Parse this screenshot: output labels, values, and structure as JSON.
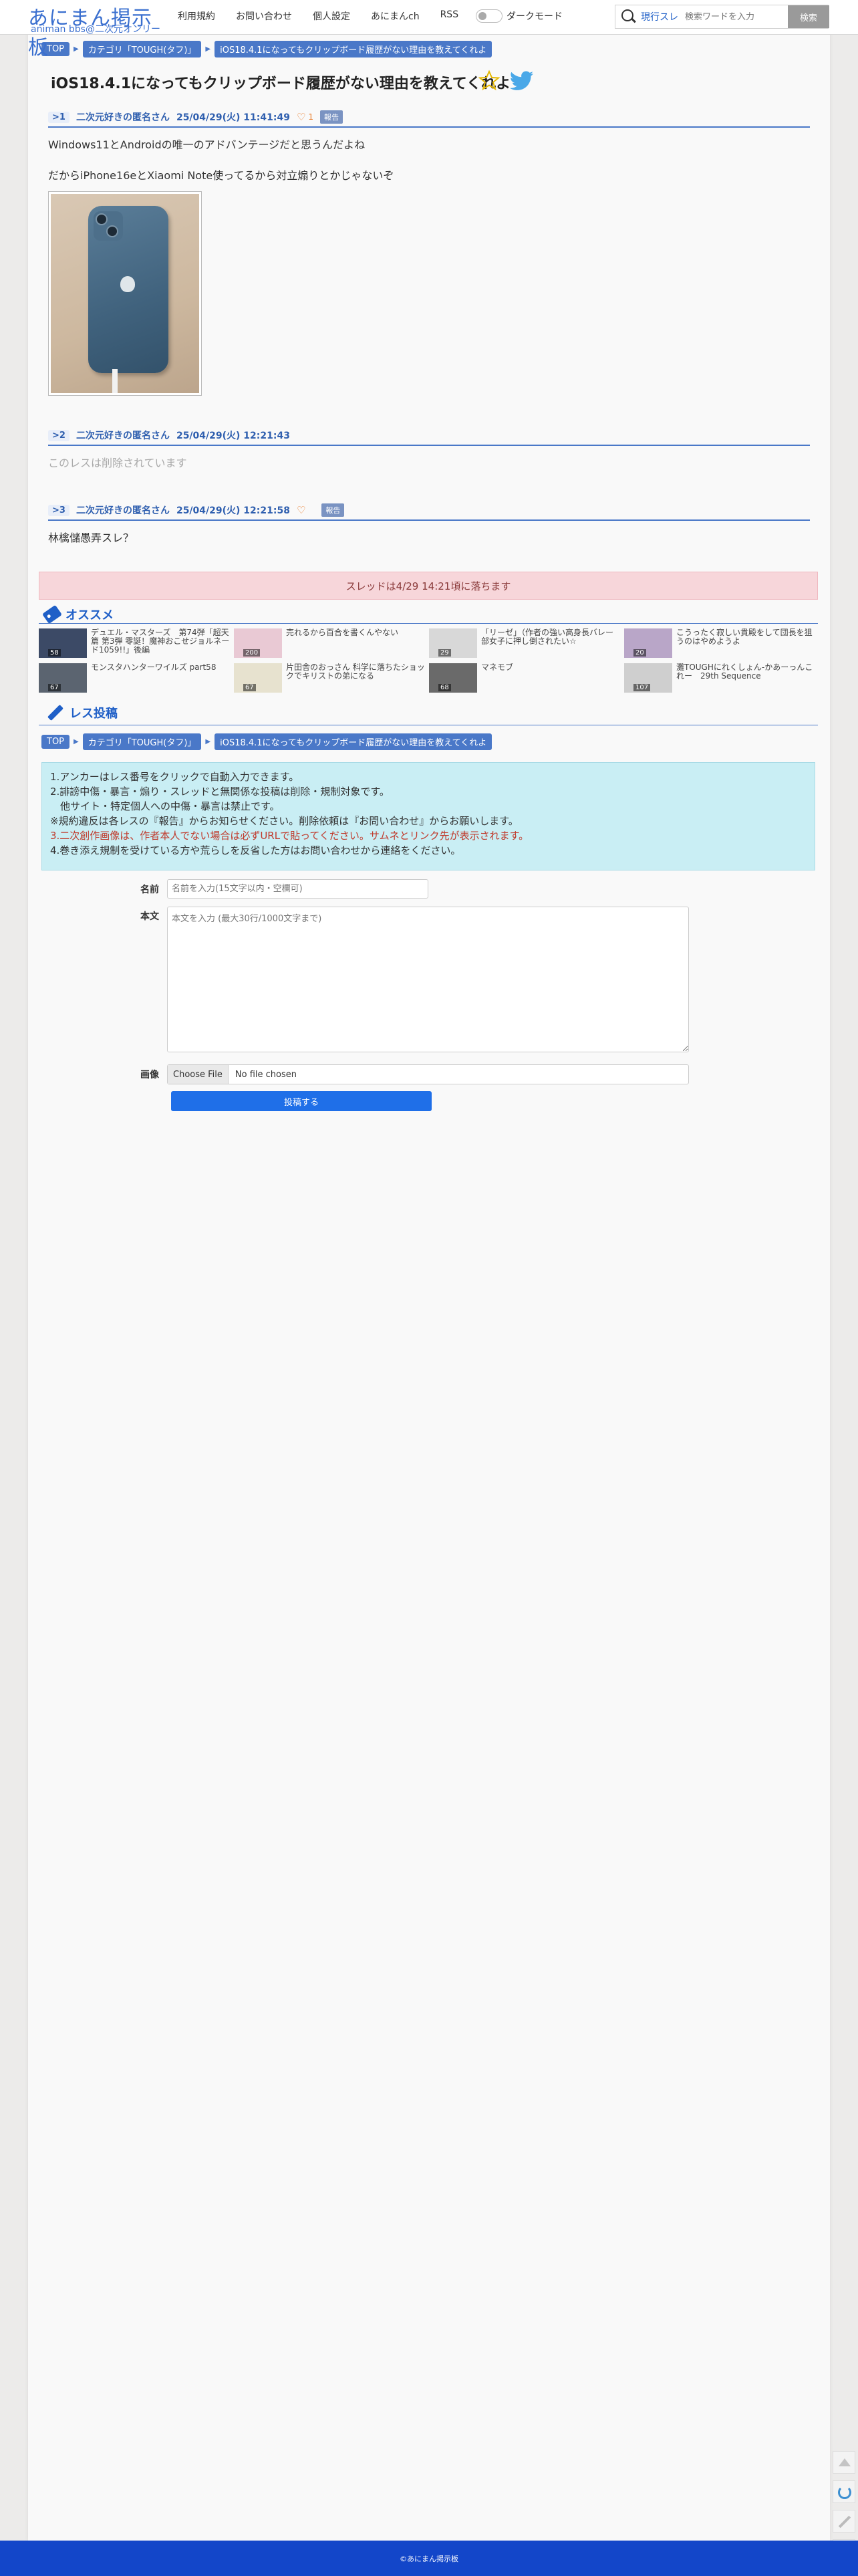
{
  "header": {
    "logo_main": "あにまん掲示板",
    "logo_sub": "animan bbs@二次元オンリー",
    "nav": [
      "利用規約",
      "お問い合わせ",
      "個人設定",
      "あにまんch",
      "RSS"
    ],
    "dark_mode_label": "ダークモード",
    "search_scope": "現行スレ",
    "search_placeholder": "検索ワードを入力",
    "search_button": "検索"
  },
  "breadcrumbs": [
    "TOP",
    "カテゴリ「TOUGH(タフ)」",
    "iOS18.4.1になってもクリップボード履歴がない理由を教えてくれよ"
  ],
  "thread_title": "iOS18.4.1になってもクリップボード履歴がない理由を教えてくれよ",
  "posts": [
    {
      "num": ">1",
      "name": "二次元好きの匿名さん",
      "date": "25/04/29(火) 11:41:49",
      "likes": "1",
      "report": "報告",
      "lines": [
        "Windows11とAndroidの唯一のアドバンテージだと思うんだよね",
        "だからiPhone16eとXiaomi Note使ってるから対立煽りとかじゃないぞ"
      ]
    },
    {
      "num": ">2",
      "name": "二次元好きの匿名さん",
      "date": "25/04/29(火) 12:21:43",
      "lines": [
        "このレスは削除されています"
      ]
    },
    {
      "num": ">3",
      "name": "二次元好きの匿名さん",
      "date": "25/04/29(火) 12:21:58",
      "report": "報告",
      "lines": [
        "林檎儲愚弄スレ？"
      ]
    }
  ],
  "expire_notice": "スレッドは4/29 14:21頃に落ちます",
  "recommend": {
    "title": "オススメ",
    "items": [
      {
        "title": "デュエル・マスターズ　第74弾「超天篇 第3弾 零誕！魔神おこせジョルネード1059!!」後編",
        "count": "58"
      },
      {
        "title": "売れるから百合を書くんやない",
        "count": "200"
      },
      {
        "title": "「リーゼ」（作者の強い高身長バレー部女子に押し倒されたい☆",
        "count": "29"
      },
      {
        "title": "こうったく寂しい貴殿をして団長を狙うのはやめようよ",
        "count": "20"
      },
      {
        "title": "モンスタハンターワイルズ part58",
        "count": "67"
      },
      {
        "title": "片田舎のおっさん 科学に落ちたショックでキリストの弟になる",
        "count": "67"
      },
      {
        "title": "マネモブ",
        "count": "68"
      },
      {
        "title": "灘TOUGHにれくしょん-かあーっんこれー　29th Sequence",
        "count": "107"
      }
    ]
  },
  "reply": {
    "title": "レス投稿",
    "rules": [
      "1.アンカーはレス番号をクリックで自動入力できます。",
      "2.誹謗中傷・暴言・煽り・スレッドと無関係な投稿は削除・規制対象です。",
      "　他サイト・特定個人への中傷・暴言は禁止です。",
      "※規約違反は各レスの『報告』からお知らせください。削除依頼は『お問い合わせ』からお願いします。",
      "3.二次創作画像は、作者本人でない場合は必ずURLで貼ってください。サムネとリンク先が表示されます。",
      "4.巻き添え規制を受けている方や荒らしを反省した方はお問い合わせから連絡をください。"
    ],
    "name_label": "名前",
    "name_placeholder": "名前を入力(15文字以内・空欄可)",
    "body_label": "本文",
    "body_placeholder": "本文を入力 (最大30行/1000文字まで)",
    "image_label": "画像",
    "file_button": "Choose File",
    "file_name": "No file chosen",
    "submit": "投稿する"
  },
  "footer": "©あにまん掲示板",
  "colors": {
    "accent": "#1f5fc7",
    "footer": "#1346c9",
    "banner": "#f7d6da",
    "rules_bg": "#c9eef4"
  }
}
